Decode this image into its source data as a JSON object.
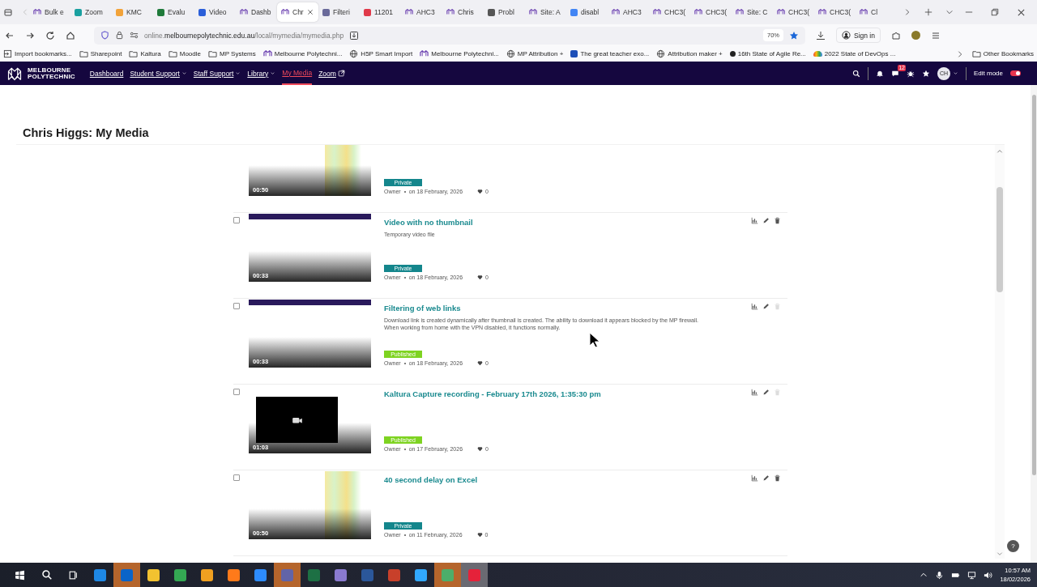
{
  "browser": {
    "tabs": [
      {
        "label": "Bulk e",
        "selected": false,
        "kind": "mp"
      },
      {
        "label": "Zoom",
        "selected": false,
        "kind": "app",
        "color": "#1aa0a0"
      },
      {
        "label": "KMC",
        "selected": false,
        "kind": "app",
        "color": "#f2a33a"
      },
      {
        "label": "Evalu",
        "selected": false,
        "kind": "app",
        "color": "#1f7a3a"
      },
      {
        "label": "Video",
        "selected": false,
        "kind": "app",
        "color": "#2b5fd9"
      },
      {
        "label": "Dashb",
        "selected": false,
        "kind": "mp"
      },
      {
        "label": "Chr",
        "selected": true,
        "kind": "mp"
      },
      {
        "label": "Filteri",
        "selected": false,
        "kind": "app",
        "color": "#6a6a9a"
      },
      {
        "label": "11201",
        "selected": false,
        "kind": "app",
        "color": "#e0394a"
      },
      {
        "label": "AHC3",
        "selected": false,
        "kind": "mp"
      },
      {
        "label": "Chris",
        "selected": false,
        "kind": "mp"
      },
      {
        "label": "Probl",
        "selected": false,
        "kind": "app",
        "color": "#555555"
      },
      {
        "label": "Site: A",
        "selected": false,
        "kind": "mp"
      },
      {
        "label": "disabl",
        "selected": false,
        "kind": "app",
        "color": "#4285f4"
      },
      {
        "label": "AHC3",
        "selected": false,
        "kind": "mp"
      },
      {
        "label": "CHC3(",
        "selected": false,
        "kind": "mp"
      },
      {
        "label": "CHC3(",
        "selected": false,
        "kind": "mp"
      },
      {
        "label": "Site: C",
        "selected": false,
        "kind": "mp"
      },
      {
        "label": "CHC3(",
        "selected": false,
        "kind": "mp"
      },
      {
        "label": "CHC3(",
        "selected": false,
        "kind": "mp"
      },
      {
        "label": "Cl",
        "selected": false,
        "kind": "mp"
      }
    ],
    "url": "online.**melbournepolytechnic.edu.au**/local/mymedia/mymedia.php",
    "zoom": "70%",
    "bookmarked": true,
    "sign_in": "Sign in",
    "bookmarks": [
      {
        "label": "Import bookmarks...",
        "kind": "import"
      },
      {
        "label": "Sharepoint",
        "kind": "folder"
      },
      {
        "label": "Kaltura",
        "kind": "folder"
      },
      {
        "label": "Moodle",
        "kind": "folder"
      },
      {
        "label": "MP Systems",
        "kind": "folder"
      },
      {
        "label": "Melbourne Polytechni...",
        "kind": "mp"
      },
      {
        "label": "H5P Smart Import",
        "kind": "globe"
      },
      {
        "label": "Melbourne Polytechni...",
        "kind": "mp"
      },
      {
        "label": "MP Attribution +",
        "kind": "globe"
      },
      {
        "label": "The great teacher exo...",
        "kind": "square"
      },
      {
        "label": "Attribution maker +",
        "kind": "globe"
      },
      {
        "label": "16th State of Agile Re...",
        "kind": "d"
      },
      {
        "label": "2022 State of DevOps ...",
        "kind": "cloud"
      }
    ],
    "other_bookmarks": "Other Bookmarks"
  },
  "site_nav": {
    "logo": [
      "MELBOURNE",
      "POLYTECHNIC"
    ],
    "items": [
      {
        "label": "Dashboard",
        "selected": false,
        "kind": "link"
      },
      {
        "label": "Student Support",
        "selected": false,
        "kind": "menu"
      },
      {
        "label": "Staff Support",
        "selected": false,
        "kind": "menu"
      },
      {
        "label": "Library",
        "selected": false,
        "kind": "menu"
      },
      {
        "label": "My Media",
        "selected": true,
        "kind": "link"
      },
      {
        "label": "Zoom",
        "selected": false,
        "kind": "external"
      }
    ],
    "message_count": "12",
    "avatar": "CH",
    "edit_mode": {
      "label": "Edit mode",
      "on": true
    }
  },
  "page": {
    "heading": "Chris Higgs: My Media",
    "media": [
      {
        "kind": "spreadsheet",
        "duration": "00:50",
        "status": {
          "label": "Private",
          "kind": "private"
        },
        "owner": "Owner",
        "date": "on 18 February, 2026",
        "likes": "0"
      },
      {
        "checked": false,
        "kind": "webpage",
        "duration": "00:33",
        "title": "Video with no thumbnail",
        "description": "Temporary video file",
        "status": {
          "label": "Private",
          "kind": "private"
        },
        "owner": "Owner",
        "date": "on 18 February, 2026",
        "likes": "0",
        "delete_enabled": true
      },
      {
        "checked": false,
        "kind": "webpage",
        "duration": "00:33",
        "title": "Filtering of web links",
        "description": "Download link is created dynamically after thumbnail is created. The ability to download it appears blocked by the MP firewall.\nWhen working from home with the VPN disabled, it functions normally.",
        "status": {
          "label": "Published",
          "kind": "published"
        },
        "owner": "Owner",
        "date": "on 18 February, 2026",
        "likes": "0",
        "delete_enabled": false
      },
      {
        "checked": false,
        "kind": "camera",
        "duration": "01:03",
        "title": "Kaltura Capture recording - February 17th 2026, 1:35:30 pm",
        "status": {
          "label": "Published",
          "kind": "published"
        },
        "owner": "Owner",
        "date": "on 17 February, 2026",
        "likes": "0",
        "delete_enabled": false
      },
      {
        "checked": false,
        "kind": "spreadsheet",
        "duration": "00:50",
        "title": "40 second delay on Excel",
        "status": {
          "label": "Private",
          "kind": "private"
        },
        "owner": "Owner",
        "date": "on 11 February, 2026",
        "likes": "0",
        "delete_enabled": true
      }
    ],
    "help": "?"
  },
  "taskbar": {
    "apps": [
      {
        "color": "#1e88e5",
        "kind": "plain"
      },
      {
        "color": "#0a64c8",
        "kind": "open"
      },
      {
        "color": "#f2c230",
        "kind": "plain"
      },
      {
        "color": "#34a853",
        "kind": "plain"
      },
      {
        "color": "#f0a020",
        "kind": "plain"
      },
      {
        "color": "#ff7a1a",
        "kind": "plain"
      },
      {
        "color": "#2d8cff",
        "kind": "plain"
      },
      {
        "color": "#6264a7",
        "kind": "open"
      },
      {
        "color": "#1d7044",
        "kind": "plain"
      },
      {
        "color": "#8a7ad0",
        "kind": "plain"
      },
      {
        "color": "#2b579a",
        "kind": "plain"
      },
      {
        "color": "#c8402a",
        "kind": "plain"
      },
      {
        "color": "#31a8ff",
        "kind": "plain"
      },
      {
        "color": "#4cae6a",
        "kind": "open"
      },
      {
        "color": "#e5223a",
        "kind": "focused"
      }
    ],
    "time": "10:57 AM",
    "date": "18/02/2026"
  }
}
